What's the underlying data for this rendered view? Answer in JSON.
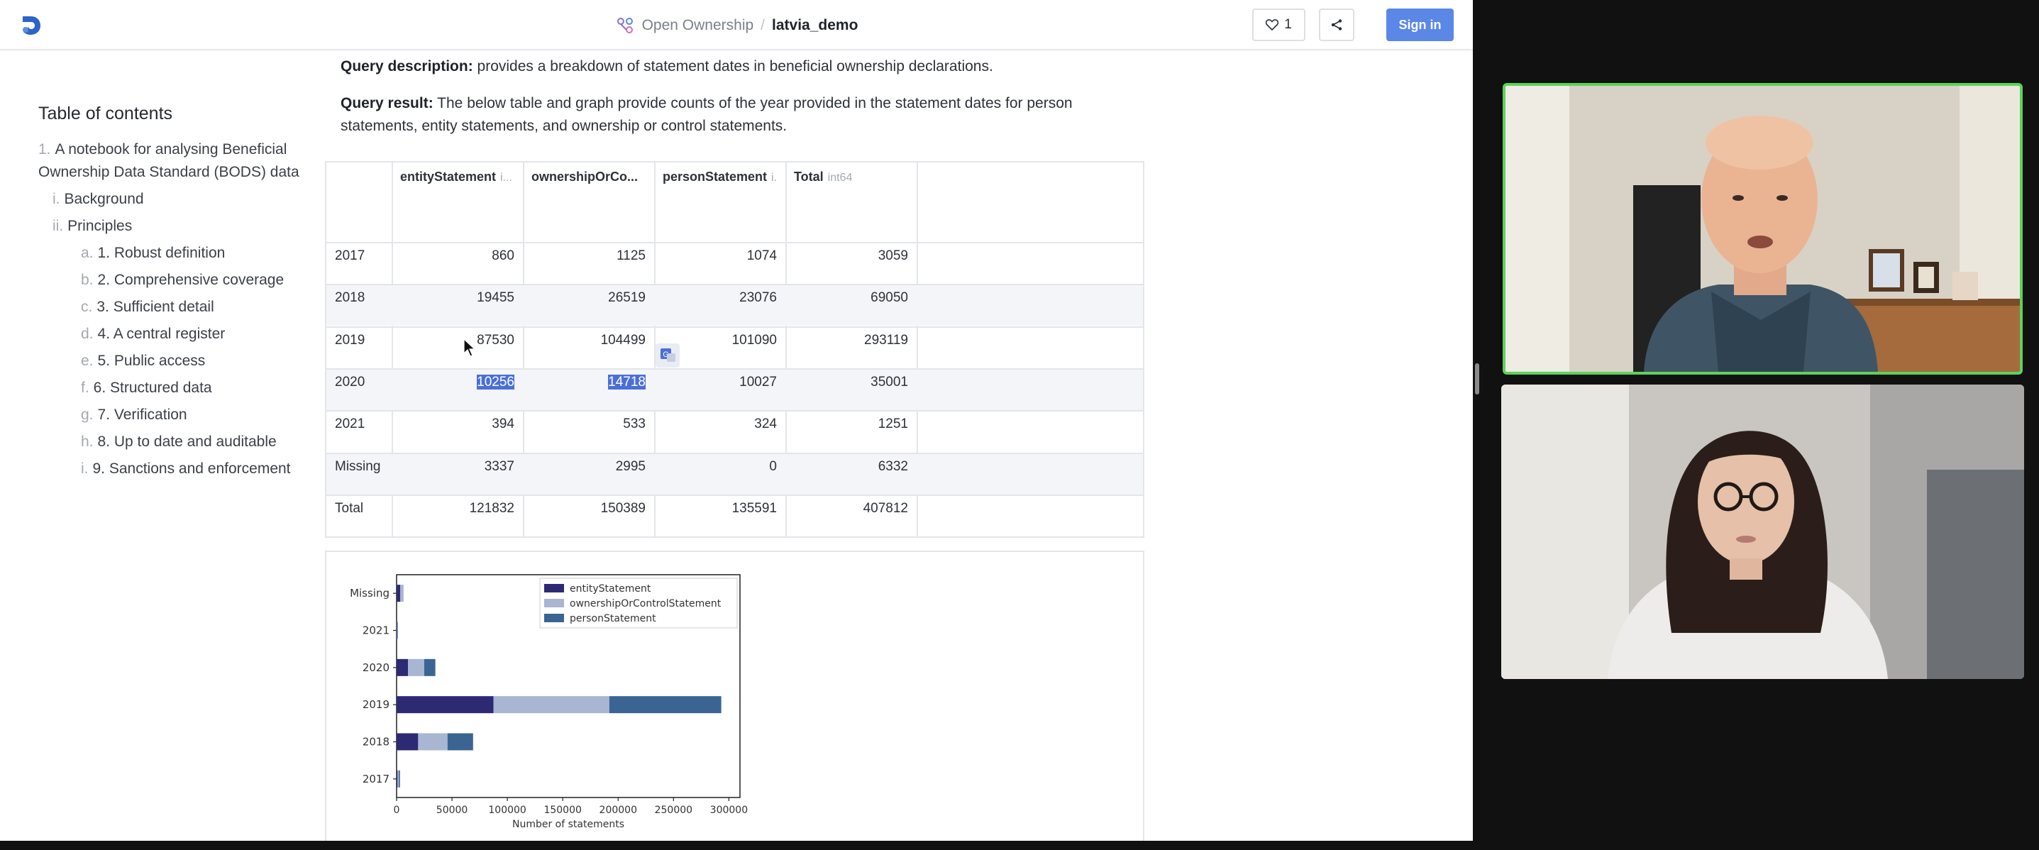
{
  "header": {
    "org": "Open Ownership",
    "separator": "/",
    "notebook": "latvia_demo",
    "like_count": "1",
    "sign_in": "Sign in",
    "icons": {
      "logo": "app-logo-icon",
      "org": "workspace-icon",
      "like": "heart-icon",
      "share": "share-icon"
    }
  },
  "toc": {
    "title": "Table of contents",
    "items": [
      {
        "num": "1.",
        "label": "A notebook for analysing Beneficial Ownership Data Standard (BODS) data"
      },
      {
        "num": "i.",
        "label": "Background"
      },
      {
        "num": "ii.",
        "label": "Principles"
      },
      {
        "num": "a.",
        "label": "1. Robust definition"
      },
      {
        "num": "b.",
        "label": "2. Comprehensive coverage"
      },
      {
        "num": "c.",
        "label": "3. Sufficient detail"
      },
      {
        "num": "d.",
        "label": "4. A central register"
      },
      {
        "num": "e.",
        "label": "5. Public access"
      },
      {
        "num": "f.",
        "label": "6. Structured data"
      },
      {
        "num": "g.",
        "label": "7. Verification"
      },
      {
        "num": "h.",
        "label": "8. Up to date and auditable"
      },
      {
        "num": "i.",
        "label": "9. Sanctions and enforcement"
      }
    ]
  },
  "content": {
    "qdesc_label": "Query description:",
    "qdesc_text": " provides a breakdown of statement dates in beneficial ownership declarations.",
    "qres_label": "Query result:",
    "qres_text": " The below table and graph provide counts of the year provided in the statement dates for person statements, entity statements, and ownership or control statements."
  },
  "table": {
    "columns": [
      {
        "name": "entityStatement",
        "dtype": "i..."
      },
      {
        "name": "ownershipOrCo...",
        "dtype": ""
      },
      {
        "name": "personStatement",
        "dtype": "i."
      },
      {
        "name": "Total",
        "dtype": "int64"
      }
    ],
    "rows": [
      {
        "index": "2017",
        "cells": [
          "860",
          "1125",
          "1074",
          "3059"
        ]
      },
      {
        "index": "2018",
        "cells": [
          "19455",
          "26519",
          "23076",
          "69050"
        ]
      },
      {
        "index": "2019",
        "cells": [
          "87530",
          "104499",
          "101090",
          "293119"
        ]
      },
      {
        "index": "2020",
        "cells": [
          "10256",
          "14718",
          "10027",
          "35001"
        ]
      },
      {
        "index": "2021",
        "cells": [
          "394",
          "533",
          "324",
          "1251"
        ]
      },
      {
        "index": "Missing",
        "cells": [
          "3337",
          "2995",
          "0",
          "6332"
        ]
      },
      {
        "index": "Total",
        "cells": [
          "121832",
          "150389",
          "135591",
          "407812"
        ]
      }
    ]
  },
  "chart_data": {
    "type": "bar",
    "stacked": true,
    "orientation": "horizontal",
    "categories": [
      "Missing",
      "2021",
      "2020",
      "2019",
      "2018",
      "2017"
    ],
    "series": [
      {
        "name": "entityStatement",
        "values": [
          3337,
          394,
          10256,
          87530,
          19455,
          860
        ],
        "color": "#2d2a73"
      },
      {
        "name": "ownershipOrControlStatement",
        "values": [
          2995,
          533,
          14718,
          104499,
          26519,
          1125
        ],
        "color": "#a8b6d2"
      },
      {
        "name": "personStatement",
        "values": [
          0,
          324,
          10027,
          101090,
          23076,
          1074
        ],
        "color": "#3a6593"
      }
    ],
    "xlabel": "Number of statements",
    "xticks": [
      "0",
      "50000",
      "100000",
      "150000",
      "200000",
      "250000",
      "300000"
    ],
    "xlim": [
      0,
      310000
    ],
    "legend": "top-right"
  },
  "video": {
    "tiles": [
      "participant-1-video",
      "participant-2-video"
    ]
  }
}
